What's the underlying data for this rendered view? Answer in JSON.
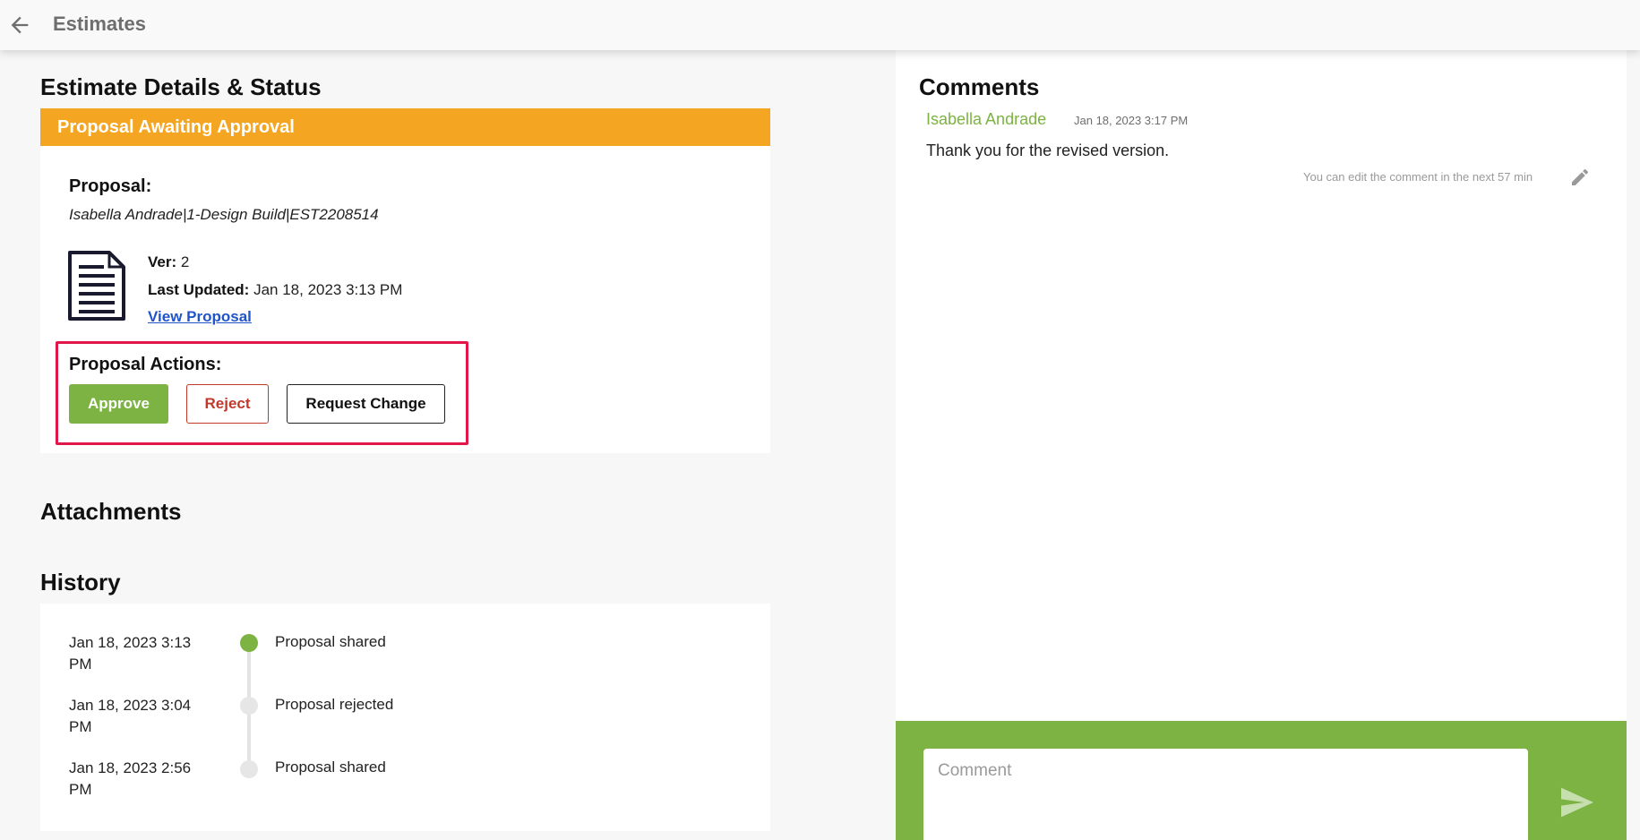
{
  "topbar": {
    "title": "Estimates"
  },
  "details": {
    "heading": "Estimate Details & Status",
    "status_banner": "Proposal Awaiting Approval",
    "proposal_label": "Proposal:",
    "proposal_name": "Isabella Andrade|1-Design Build|EST2208514",
    "version_label": "Ver:",
    "version_value": "2",
    "last_updated_label": "Last Updated:",
    "last_updated_value": "Jan 18, 2023 3:13 PM",
    "view_link": "View Proposal",
    "actions_label": "Proposal Actions:",
    "approve_label": "Approve",
    "reject_label": "Reject",
    "request_change_label": "Request Change"
  },
  "attachments": {
    "heading": "Attachments"
  },
  "history": {
    "heading": "History",
    "items": [
      {
        "date": "Jan 18, 2023 3:13 PM",
        "event": "Proposal shared",
        "active": true
      },
      {
        "date": "Jan 18, 2023 3:04 PM",
        "event": "Proposal rejected",
        "active": false
      },
      {
        "date": "Jan 18, 2023 2:56 PM",
        "event": "Proposal shared",
        "active": false
      }
    ]
  },
  "comments": {
    "heading": "Comments",
    "items": [
      {
        "author": "Isabella Andrade",
        "time": "Jan 18, 2023 3:17 PM",
        "text": "Thank you for the revised version.",
        "edit_note": "You can edit the comment in the next 57 min"
      }
    ],
    "input_placeholder": "Comment"
  },
  "icons": {
    "back": "arrow-left-icon",
    "document": "document-icon",
    "edit": "pencil-icon",
    "send": "send-icon"
  },
  "colors": {
    "status_banner": "#f4a521",
    "accent_green": "#7cb342",
    "reject_red": "#c0392b",
    "link_blue": "#1f55c9",
    "highlight_box": "#e1174a"
  }
}
